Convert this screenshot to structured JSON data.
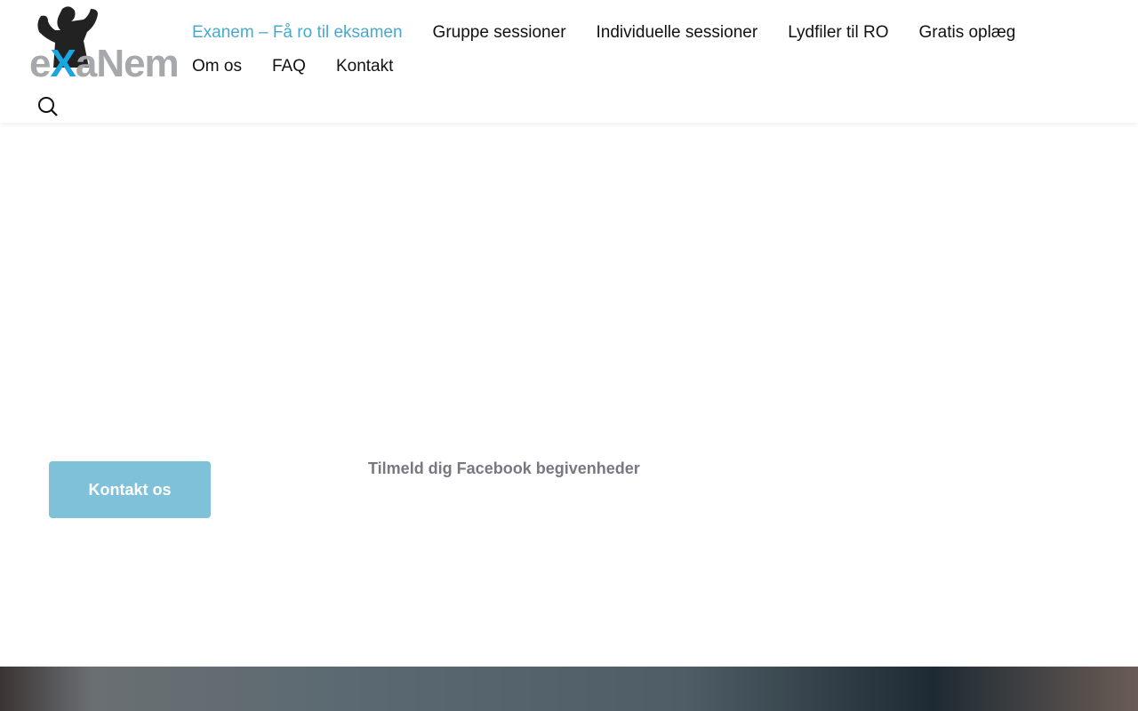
{
  "logo": {
    "text_pre": "e",
    "text_x": "X",
    "text_post": "aNem"
  },
  "nav": {
    "items": [
      {
        "label": "Exanem – Få ro til eksamen",
        "active": true
      },
      {
        "label": "Gruppe sessioner"
      },
      {
        "label": "Individuelle sessioner"
      },
      {
        "label": "Lydfiler til RO"
      },
      {
        "label": "Gratis oplæg"
      },
      {
        "label": "Om os"
      },
      {
        "label": "FAQ"
      },
      {
        "label": "Kontakt"
      }
    ]
  },
  "main": {
    "contact_button": "Kontakt os",
    "facebook_link": "Tilmeld dig Facebook begivenheder"
  },
  "colors": {
    "accent": "#48a9cf",
    "button": "#7fc1d8"
  }
}
